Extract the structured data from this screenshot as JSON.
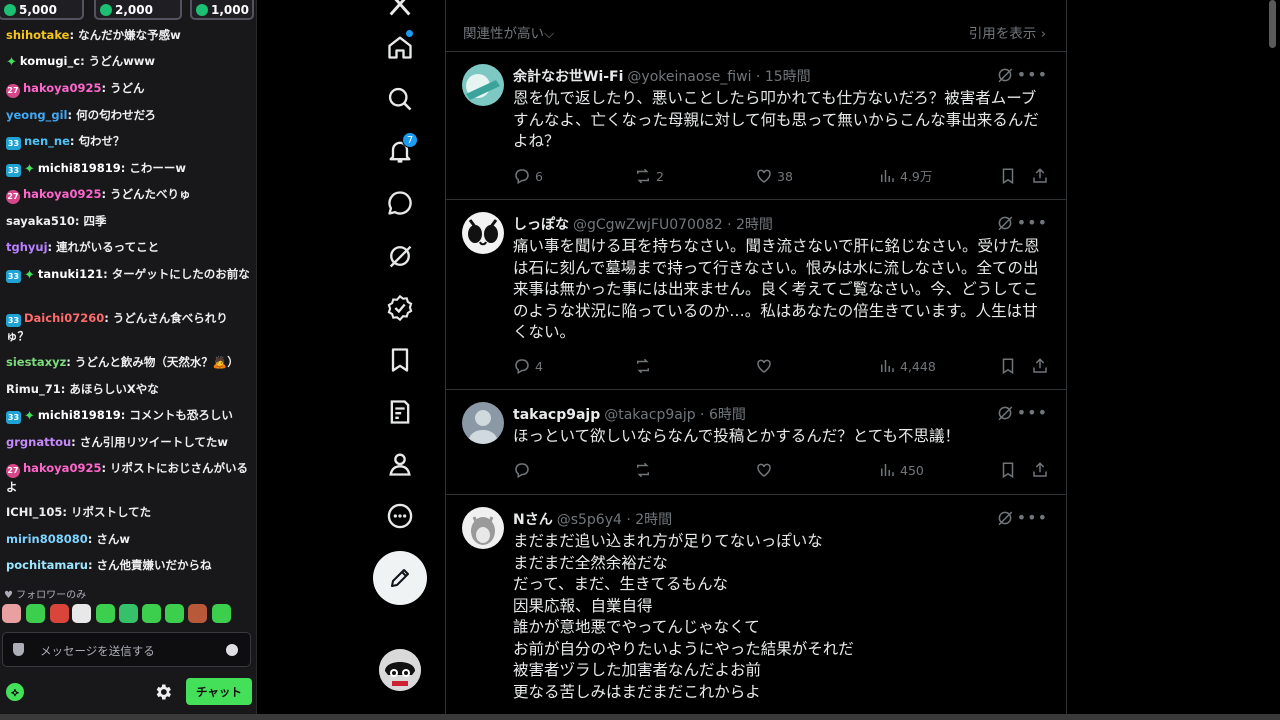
{
  "chat": {
    "bits": [
      {
        "label": "5,000",
        "color": "#5b5b66"
      },
      {
        "label": "2,000",
        "color": "#b23bb5"
      },
      {
        "label": "1,000",
        "color": "#1db3a5"
      }
    ],
    "messages": [
      {
        "user": "shihotake",
        "color": "#f5c518",
        "badges": [],
        "text": ": なんだか嫌な予感w"
      },
      {
        "user": "komugi_c",
        "color": "#ffffff",
        "badges": [
          "star"
        ],
        "text": ": うどんwww"
      },
      {
        "user": "hakoya0925",
        "color": "#ff66cc",
        "badges": [
          "pink"
        ],
        "text": ": うどん"
      },
      {
        "user": "yeong_gil",
        "color": "#3fa9f5",
        "badges": [],
        "text": ": 何の匂わせだろ"
      },
      {
        "user": "nen_ne",
        "color": "#4fc3f7",
        "badges": [
          "sub"
        ],
        "text": ": 匂わせ？"
      },
      {
        "user": "michi819819",
        "color": "#ffffff",
        "badges": [
          "sub",
          "star"
        ],
        "text": ": こわーーw"
      },
      {
        "user": "hakoya0925",
        "color": "#ff66cc",
        "badges": [
          "pink"
        ],
        "text": ": うどんたべりゅ"
      },
      {
        "user": "sayaka510",
        "color": "#efeff1",
        "badges": [],
        "text": ": 四季"
      },
      {
        "user": "tghyuj",
        "color": "#b980ff",
        "badges": [],
        "text": ": 連れがいるってこと"
      },
      {
        "user": "tanuki121",
        "color": "#ffffff",
        "badges": [
          "sub",
          "star"
        ],
        "text": ": ターゲットにしたのお前な"
      },
      {
        "user": "Daichi07260",
        "color": "#ff6b6b",
        "badges": [
          "sub"
        ],
        "text": ": うどんさん食べられりゅ？"
      },
      {
        "user": "siestaxyz",
        "color": "#7cd97c",
        "badges": [],
        "text": ": うどんと飲み物（天然水？🙇）"
      },
      {
        "user": "Rimu_71",
        "color": "#efeff1",
        "badges": [],
        "text": ": あほらしいXやな"
      },
      {
        "user": "michi819819",
        "color": "#ffffff",
        "badges": [
          "sub",
          "star"
        ],
        "text": ": コメントも恐ろしい"
      },
      {
        "user": "grgnattou",
        "color": "#c58af9",
        "badges": [],
        "text": ": さん引用リツイートしてたw"
      },
      {
        "user": "hakoya0925",
        "color": "#ff66cc",
        "badges": [
          "pink"
        ],
        "text": ": リポストにおじさんがいるよ"
      },
      {
        "user": "ICHI_105",
        "color": "#efeff1",
        "badges": [],
        "text": ": リポストしてた"
      },
      {
        "user": "mirin808080",
        "color": "#7fd4ff",
        "badges": [],
        "text": ": さんw"
      },
      {
        "user": "pochitamaru",
        "color": "#9ae6ff",
        "badges": [],
        "text": ": さん他責嫌いだからね"
      }
    ],
    "follow_only": "♥ フォロワーのみ",
    "input_placeholder": "メッセージを送信する",
    "send_label": "チャット",
    "points_glyph": "⟡"
  },
  "nav": {
    "notification_count": "7"
  },
  "timeline": {
    "sort_label": "関連性が高い⌵",
    "quote_link": "引用を表示 ›",
    "posts": [
      {
        "name": "余計なお世Wi-Fi",
        "handle": "@yokeinaose_fiwi · 15時間",
        "text": "恩を仇で返したり、悪いことしたら叩かれても仕方ないだろ？被害者ムーブ\nすんなよ、亡くなった母親に対して何も思って無いからこんな事出来るんだ\nよね？",
        "replies": "6",
        "reposts": "2",
        "likes": "38",
        "views": "4.9万"
      },
      {
        "name": "しっぽな",
        "handle": "@gCgwZwjFU070082 · 2時間",
        "text": "痛い事を聞ける耳を持ちなさい。聞き流さないで肝に銘じなさい。受けた恩\nは石に刻んで墓場まで持って行きなさい。恨みは水に流しなさい。全ての出\n来事は無かった事には出来ません。良く考えてご覧なさい。今、どうしてこ\nのような状況に陥っているのか…。私はあなたの倍生きています。人生は甘\nくない。",
        "replies": "4",
        "reposts": "",
        "likes": "",
        "views": "4,448"
      },
      {
        "name": "takacp9ajp",
        "handle": "@takacp9ajp · 6時間",
        "text": "ほっといて欲しいならなんで投稿とかするんだ？とても不思議！",
        "replies": "",
        "reposts": "",
        "likes": "",
        "views": "450"
      },
      {
        "name": "Nさん",
        "handle": "@s5p6y4 · 2時間",
        "text": "まだまだ追い込まれ方が足りてないっぽいな\nまだまだ全然余裕だな\nだって、まだ、生きてるもんな\n因果応報、自業自得\n誰かが意地悪でやってんじゃなくて\nお前が自分のやりたいようにやった結果がそれだ\n被害者ヅラした加害者なんだよお前\n更なる苦しみはまだまだこれからよ",
        "replies": "",
        "reposts": "",
        "likes": "",
        "views": ""
      }
    ]
  }
}
